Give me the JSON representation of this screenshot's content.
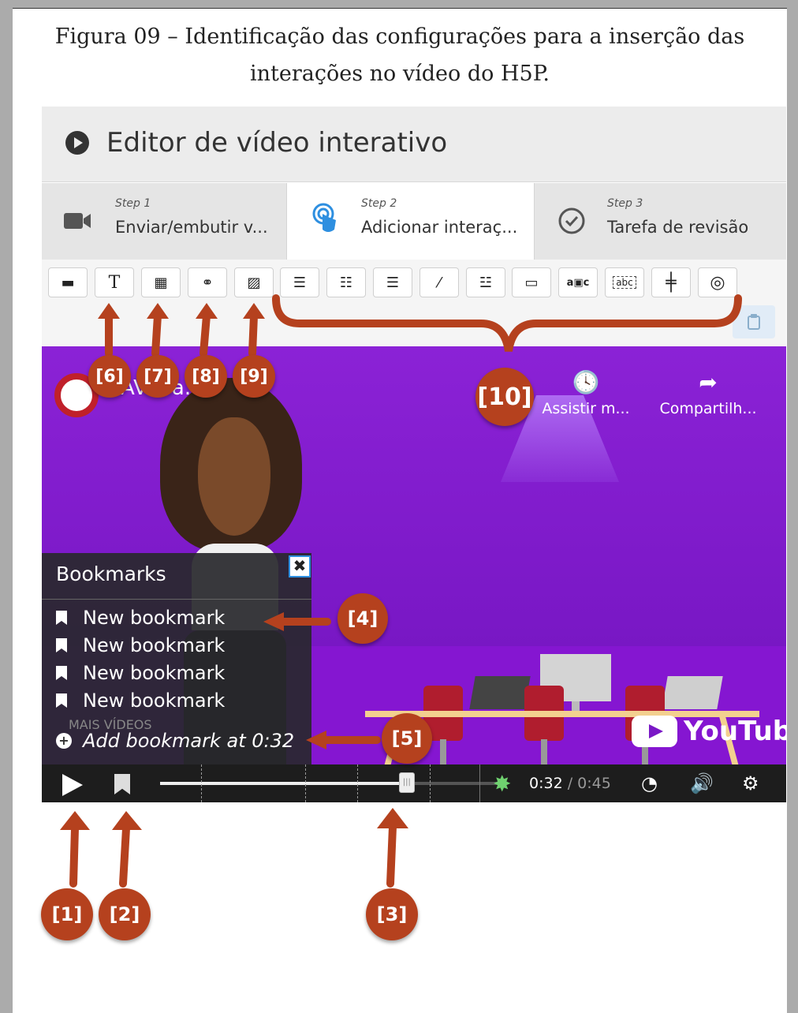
{
  "caption": {
    "line1": "Figura 09 – Identificação das configurações para a inserção das",
    "line2": "interações no vídeo do H5P."
  },
  "editor": {
    "title": "Editor de vídeo interativo",
    "title_icon": "play-circle-icon",
    "steps": [
      {
        "small": "Step 1",
        "label": "Enviar/embutir v...",
        "icon": "video-camera-icon",
        "active": false
      },
      {
        "small": "Step 2",
        "label": "Adicionar interaç...",
        "icon": "pointer-touch-icon",
        "active": true
      },
      {
        "small": "Step 3",
        "label": "Tarefa de revisão",
        "icon": "check-circle-icon",
        "active": false
      }
    ],
    "toolbar": [
      {
        "name": "minus-icon",
        "glyph": "▬"
      },
      {
        "name": "text-icon",
        "glyph": "T"
      },
      {
        "name": "table-icon",
        "glyph": "▦"
      },
      {
        "name": "link-icon",
        "glyph": "⚭"
      },
      {
        "name": "image-icon",
        "glyph": "▨"
      },
      {
        "name": "list-icon",
        "glyph": "☰"
      },
      {
        "name": "single-choice-icon",
        "glyph": "☷"
      },
      {
        "name": "multichoice-icon",
        "glyph": "☰"
      },
      {
        "name": "fill-blanks-icon",
        "glyph": "⁄"
      },
      {
        "name": "drag-drop-icon",
        "glyph": "☳"
      },
      {
        "name": "summary-icon",
        "glyph": "▭"
      },
      {
        "name": "mark-words-icon",
        "glyph": "a▣c"
      },
      {
        "name": "drag-text-icon",
        "glyph": "abc"
      },
      {
        "name": "crossroads-icon",
        "glyph": "╪"
      },
      {
        "name": "navigation-hotspot-icon",
        "glyph": "◎"
      }
    ],
    "paste_icon": "clipboard-icon"
  },
  "video": {
    "channel_partial": "AV..Ba...o",
    "actions": [
      {
        "icon": "clock-icon",
        "glyph": "🕓",
        "label": "Assistir m..."
      },
      {
        "icon": "share-icon",
        "glyph": "➦",
        "label": "Compartilh..."
      }
    ],
    "youtube_brand": "YouTube",
    "more_videos": "MAIS VÍDEOS"
  },
  "bookmarks": {
    "title": "Bookmarks",
    "close": "✖",
    "items": [
      "New bookmark",
      "New bookmark",
      "New bookmark",
      "New bookmark"
    ],
    "add_label": "Add bookmark at 0:32"
  },
  "controls": {
    "current": "0:32",
    "separator": " / ",
    "total": "0:45",
    "progress": 0.711
  },
  "callouts": {
    "c1": "[1]",
    "c2": "[2]",
    "c3": "[3]",
    "c4": "[4]",
    "c5": "[5]",
    "c6": "[6]",
    "c7": "[7]",
    "c8": "[8]",
    "c9": "[9]",
    "c10": "[10]"
  },
  "colors": {
    "callout": "#b5411e",
    "video_purple": "#8b22d6",
    "accent_blue": "#2e8fe0"
  }
}
